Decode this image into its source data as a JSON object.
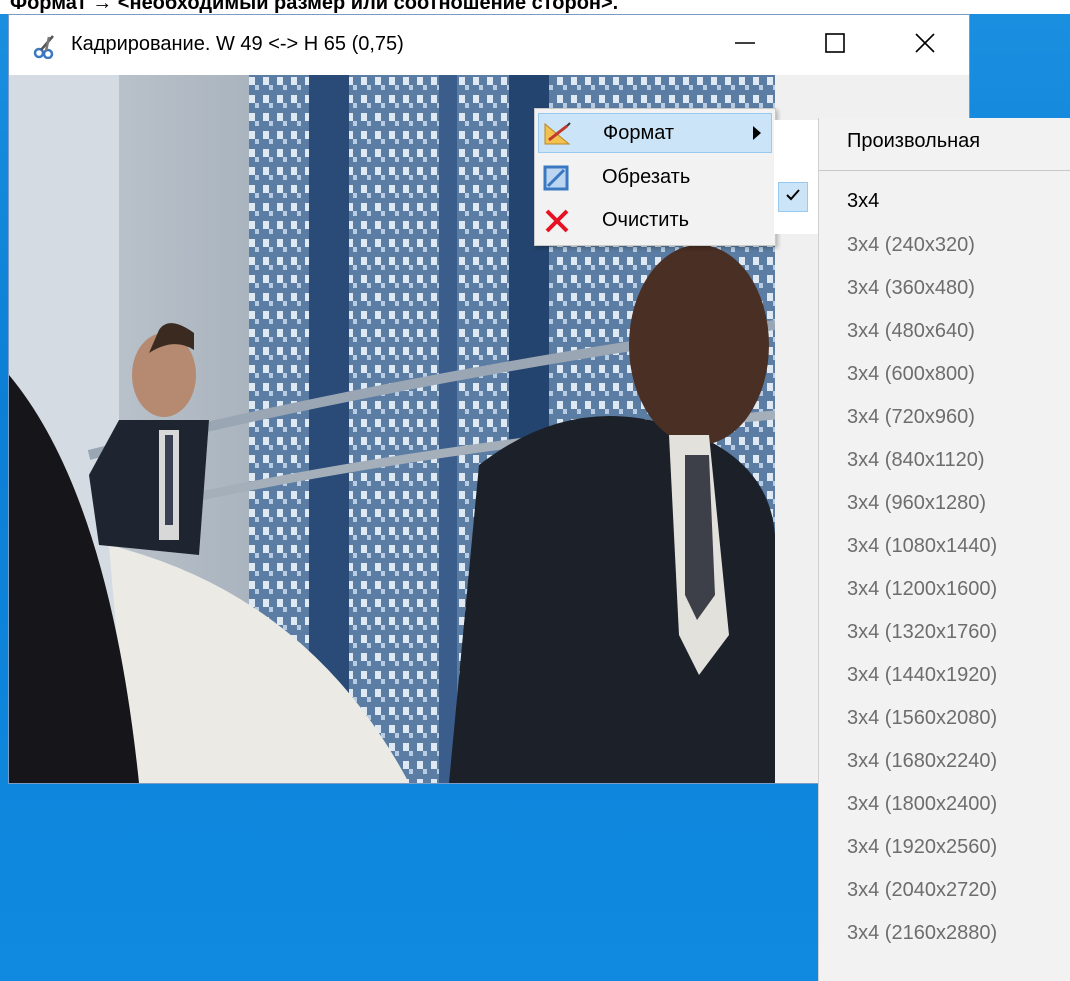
{
  "caption": "Формат → <необходимый размер или соотношение сторон>.",
  "window": {
    "title": "Кадрирование. W 49 <-> H 65 (0,75)",
    "app_icon": "scissors-icon",
    "buttons": {
      "minimize": "minimize-icon",
      "maximize": "maximize-icon",
      "close": "close-icon"
    }
  },
  "context_menu": {
    "items": [
      {
        "label": "Формат",
        "icon": "ruler-pencil-icon",
        "has_submenu": true,
        "highlighted": true
      },
      {
        "label": "Обрезать",
        "icon": "crop-icon"
      },
      {
        "label": "Очистить",
        "icon": "clear-x-icon"
      }
    ]
  },
  "submenu": {
    "header": "Произвольная",
    "items": [
      {
        "label": "3x4",
        "checked": true,
        "enabled": true
      },
      {
        "label": "3x4 (240x320)",
        "enabled": false
      },
      {
        "label": "3x4 (360x480)",
        "enabled": false
      },
      {
        "label": "3x4 (480x640)",
        "enabled": false
      },
      {
        "label": "3x4 (600x800)",
        "enabled": false
      },
      {
        "label": "3x4 (720x960)",
        "enabled": false
      },
      {
        "label": "3x4 (840x1120)",
        "enabled": false
      },
      {
        "label": "3x4 (960x1280)",
        "enabled": false
      },
      {
        "label": "3x4 (1080x1440)",
        "enabled": false
      },
      {
        "label": "3x4 (1200x1600)",
        "enabled": false
      },
      {
        "label": "3x4 (1320x1760)",
        "enabled": false
      },
      {
        "label": "3x4 (1440x1920)",
        "enabled": false
      },
      {
        "label": "3x4 (1560x2080)",
        "enabled": false
      },
      {
        "label": "3x4 (1680x2240)",
        "enabled": false
      },
      {
        "label": "3x4 (1800x2400)",
        "enabled": false
      },
      {
        "label": "3x4 (1920x2560)",
        "enabled": false
      },
      {
        "label": "3x4 (2040x2720)",
        "enabled": false
      },
      {
        "label": "3x4 (2160x2880)",
        "enabled": false
      }
    ]
  },
  "colors": {
    "desktop": "#0b7fd6",
    "menu_highlight": "#cce4f7",
    "disabled_text": "#6d6d6d",
    "clear_icon": "#e81123"
  }
}
